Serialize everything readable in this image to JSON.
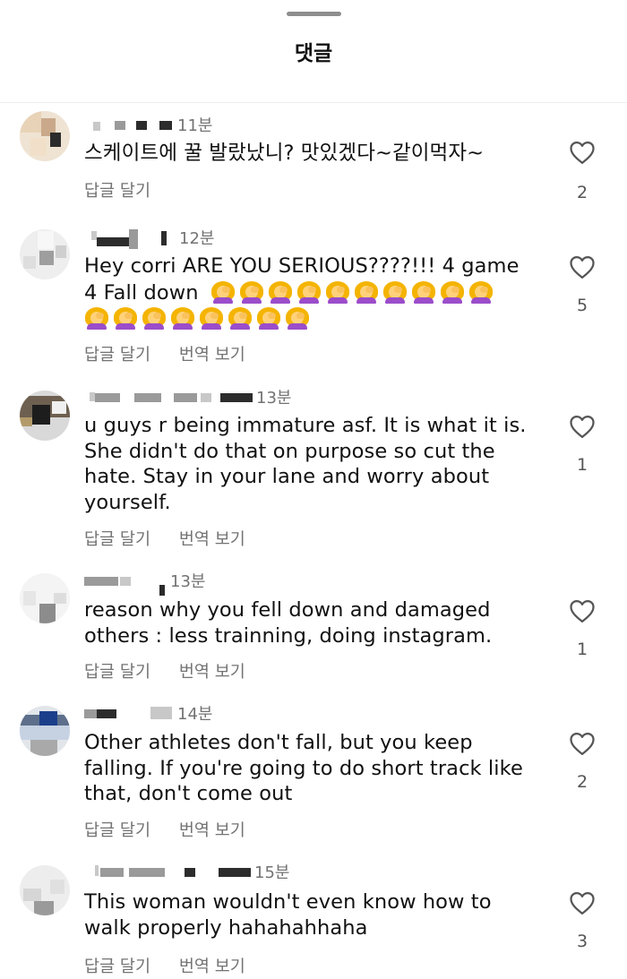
{
  "sheet": {
    "title": "댓글"
  },
  "comments": [
    {
      "time": "11분",
      "text": "스케이트에 꿀 발랐났니? 맛있겠다~같이먹자~",
      "actions": [
        "답글 달기"
      ],
      "likes": "2"
    },
    {
      "time": "12분",
      "text_line1": "Hey corri ARE YOU SERIOUS????!!! 4 game",
      "text_line2": "4 Fall down",
      "emoji_icon": "woman-facepalming-emoji",
      "emoji_count_line2": 10,
      "emoji_count_line3": 8,
      "actions": [
        "답글 달기",
        "번역 보기"
      ],
      "likes": "5"
    },
    {
      "time": "13분",
      "text": "u guys r being immature asf. It is what it is. She didn't do that on purpose so cut the hate. Stay in your lane and worry about yourself.",
      "actions": [
        "답글 달기",
        "번역 보기"
      ],
      "likes": "1"
    },
    {
      "time": "13분",
      "text": "reason why you fell down and damaged others : less trainning, doing instagram.",
      "actions": [
        "답글 달기",
        "번역 보기"
      ],
      "likes": "1"
    },
    {
      "time": "14분",
      "text": "Other athletes don't fall, but you keep falling. If you're going to do short track like that, don't come out",
      "actions": [
        "답글 달기",
        "번역 보기"
      ],
      "likes": "2"
    },
    {
      "time": "15분",
      "text": "This woman wouldn't even know how to walk properly hahahahhaha",
      "actions": [
        "답글 달기",
        "번역 보기"
      ],
      "likes": "3"
    }
  ]
}
